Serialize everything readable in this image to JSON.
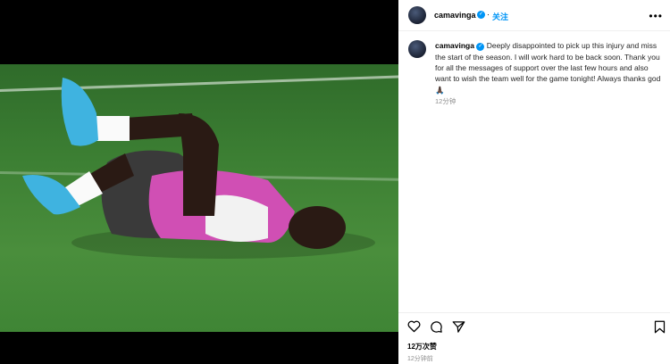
{
  "post": {
    "username": "camavinga",
    "follow_label": "关注",
    "caption_username": "camavinga",
    "caption_text": "Deeply disappointed to pick up this injury and miss the start of the season. I will work hard to be back soon. Thank you for all the messages of support over the last few hours and also want to wish the team well for the game tonight! Always thanks god 🙏🏿",
    "caption_time": "12分钟",
    "views": "12万次赞",
    "time_ago": "12分钟前"
  },
  "icons": [
    "verified-badge-icon",
    "more-options-icon",
    "heart-icon",
    "comment-icon",
    "share-icon",
    "bookmark-icon"
  ],
  "colors": {
    "accent": "#0095f6",
    "muted": "#8e8e8e",
    "text": "#262626",
    "jersey": "#d04fb4"
  }
}
